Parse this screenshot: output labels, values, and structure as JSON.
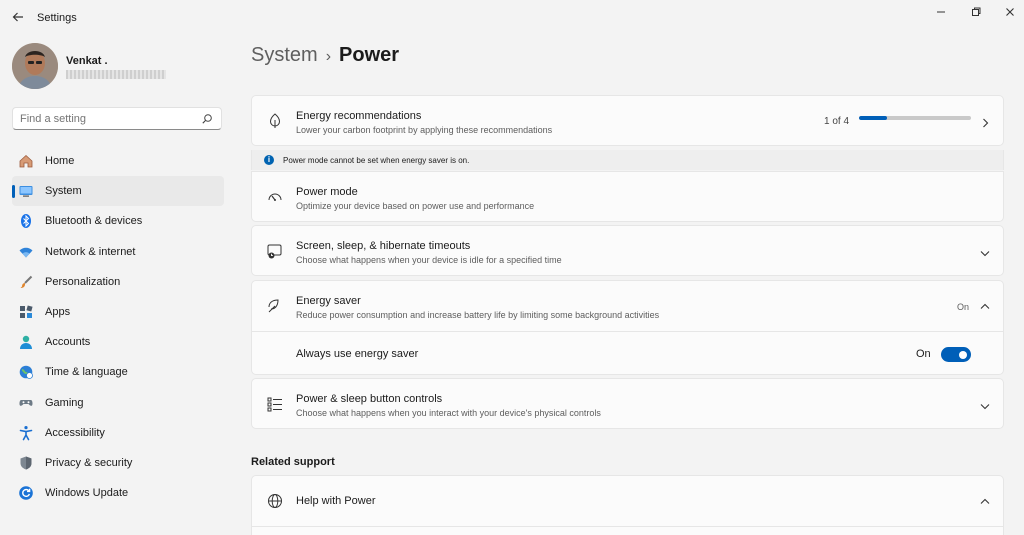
{
  "window": {
    "title": "Settings",
    "back_icon": "back-arrow-icon",
    "controls": [
      "minimize-icon",
      "maximize-icon",
      "close-icon"
    ]
  },
  "user": {
    "name": "Venkat ."
  },
  "search": {
    "placeholder": "Find a setting",
    "icon": "search-icon"
  },
  "nav": [
    {
      "label": "Home",
      "icon": "home-icon"
    },
    {
      "label": "System",
      "icon": "system-icon",
      "active": true
    },
    {
      "label": "Bluetooth & devices",
      "icon": "bluetooth-icon"
    },
    {
      "label": "Network & internet",
      "icon": "wifi-icon"
    },
    {
      "label": "Personalization",
      "icon": "brush-icon"
    },
    {
      "label": "Apps",
      "icon": "apps-icon"
    },
    {
      "label": "Accounts",
      "icon": "accounts-icon"
    },
    {
      "label": "Time & language",
      "icon": "time-language-icon"
    },
    {
      "label": "Gaming",
      "icon": "gaming-icon"
    },
    {
      "label": "Accessibility",
      "icon": "accessibility-icon"
    },
    {
      "label": "Privacy & security",
      "icon": "shield-icon"
    },
    {
      "label": "Windows Update",
      "icon": "windows-update-icon"
    }
  ],
  "breadcrumb": {
    "parent": "System",
    "separator": "›",
    "current": "Power"
  },
  "energy_recommendations": {
    "title": "Energy recommendations",
    "subtitle": "Lower your carbon footprint by applying these recommendations",
    "progress_text": "1 of 4",
    "progress_fraction": 0.25,
    "icon": "leaf-icon"
  },
  "info_banner": {
    "text": "Power mode cannot be set when energy saver is on."
  },
  "power_mode": {
    "title": "Power mode",
    "subtitle": "Optimize your device based on power use and performance",
    "icon": "gauge-icon"
  },
  "screen_sleep": {
    "title": "Screen, sleep, & hibernate timeouts",
    "subtitle": "Choose what happens when your device is idle for a specified time",
    "icon": "screen-sleep-icon"
  },
  "energy_saver": {
    "title": "Energy saver",
    "subtitle": "Reduce power consumption and increase battery life by limiting some background activities",
    "status": "On",
    "icon": "energy-saver-leaf-icon",
    "always_use_label": "Always use energy saver",
    "toggle_state": "On"
  },
  "power_button": {
    "title": "Power & sleep button controls",
    "subtitle": "Choose what happens when you interact with your device's physical controls",
    "icon": "list-controls-icon"
  },
  "related_support": {
    "heading": "Related support",
    "help_title": "Help with Power",
    "icon": "globe-icon"
  },
  "colors": {
    "accent": "#005fb8",
    "background": "#f3f3f3",
    "card": "#fbfbfb"
  }
}
